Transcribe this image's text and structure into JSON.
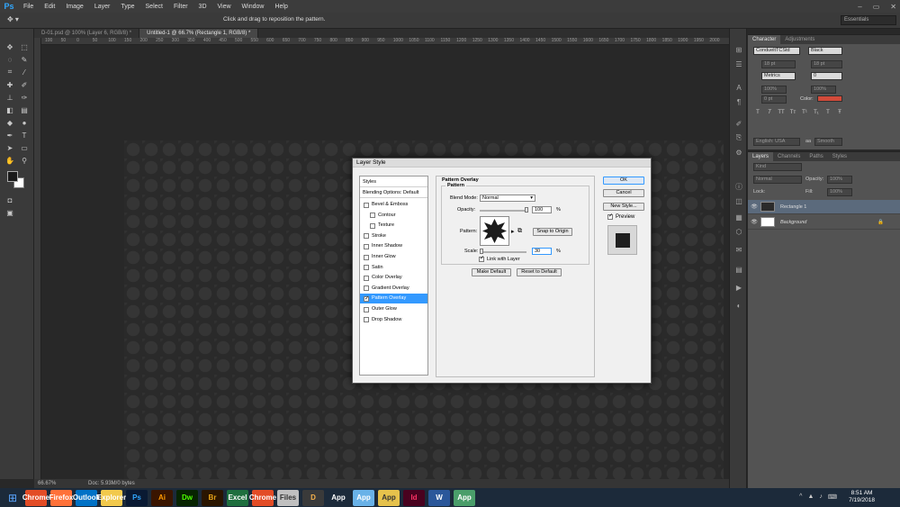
{
  "menubar": {
    "app_icon": "Ps",
    "items": [
      "File",
      "Edit",
      "Image",
      "Layer",
      "Type",
      "Select",
      "Filter",
      "3D",
      "View",
      "Window",
      "Help"
    ]
  },
  "options": {
    "hint": "Click and drag to reposition the pattern.",
    "workspace": "Essentials"
  },
  "tabs": [
    {
      "label": "D-01.psd @ 100% (Layer 6, RGB/8) *",
      "active": false
    },
    {
      "label": "Untitled-1 @ 66.7% (Rectangle 1, RGB/8) *",
      "active": true
    }
  ],
  "ruler_ticks": [
    "100",
    "50",
    "0",
    "50",
    "100",
    "150",
    "200",
    "250",
    "300",
    "350",
    "400",
    "450",
    "500",
    "550",
    "600",
    "650",
    "700",
    "750",
    "800",
    "850",
    "900",
    "950",
    "1000",
    "1050",
    "1100",
    "1150",
    "1200",
    "1250",
    "1300",
    "1350",
    "1400",
    "1450",
    "1500",
    "1550",
    "1600",
    "1650",
    "1700",
    "1750",
    "1800",
    "1850",
    "1900",
    "1950",
    "2000"
  ],
  "status": {
    "zoom": "66.67%",
    "doc": "Doc: 5.93M/0 bytes"
  },
  "character": {
    "tabs": [
      "Character",
      "Adjustments"
    ],
    "font": "CondueltTCStd",
    "style": "Black",
    "size": "18 pt",
    "leading": "18 pt",
    "kerning": "Metrics",
    "tracking": "0",
    "vscale": "100%",
    "hscale": "100%",
    "baseline": "0 pt",
    "color_label": "Color:",
    "language": "English: USA",
    "aa": "aa",
    "antialias": "Smooth"
  },
  "layers": {
    "tabs": [
      "Layers",
      "Channels",
      "Paths",
      "Styles"
    ],
    "filter": "Kind",
    "blend": "Normal",
    "opacity_label": "Opacity:",
    "opacity": "100%",
    "lock_label": "Lock:",
    "fill_label": "Fill:",
    "fill": "100%",
    "items": [
      {
        "name": "Rectangle 1",
        "selected": true
      },
      {
        "name": "Background",
        "selected": false
      }
    ]
  },
  "dialog": {
    "title": "Layer Style",
    "styles": [
      {
        "label": "Styles",
        "type": "header"
      },
      {
        "label": "Blending Options: Default",
        "type": "header"
      },
      {
        "label": "Bevel & Emboss",
        "checked": false,
        "indent": false,
        "selected": false
      },
      {
        "label": "Contour",
        "checked": false,
        "indent": true,
        "selected": false
      },
      {
        "label": "Texture",
        "checked": false,
        "indent": true,
        "selected": false
      },
      {
        "label": "Stroke",
        "checked": false,
        "indent": false,
        "selected": false
      },
      {
        "label": "Inner Shadow",
        "checked": false,
        "indent": false,
        "selected": false
      },
      {
        "label": "Inner Glow",
        "checked": false,
        "indent": false,
        "selected": false
      },
      {
        "label": "Satin",
        "checked": false,
        "indent": false,
        "selected": false
      },
      {
        "label": "Color Overlay",
        "checked": false,
        "indent": false,
        "selected": false
      },
      {
        "label": "Gradient Overlay",
        "checked": false,
        "indent": false,
        "selected": false
      },
      {
        "label": "Pattern Overlay",
        "checked": true,
        "indent": false,
        "selected": true
      },
      {
        "label": "Outer Glow",
        "checked": false,
        "indent": false,
        "selected": false
      },
      {
        "label": "Drop Shadow",
        "checked": false,
        "indent": false,
        "selected": false
      }
    ],
    "section_title": "Pattern Overlay",
    "group_title": "Pattern",
    "blend_mode_label": "Blend Mode:",
    "blend_mode": "Normal",
    "opacity_label": "Opacity:",
    "opacity_value": "100",
    "opacity_level": 1.0,
    "percent": "%",
    "pattern_label": "Pattern:",
    "snap_button": "Snap to Origin",
    "scale_label": "Scale:",
    "scale_value": "30",
    "scale_level": 0.03,
    "link_label": "Link with Layer",
    "link_checked": true,
    "make_default": "Make Default",
    "reset_default": "Reset to Default",
    "ok": "OK",
    "cancel": "Cancel",
    "new_style": "New Style...",
    "preview_label": "Preview",
    "preview_checked": true
  },
  "taskbar": {
    "apps": [
      "Chrome",
      "Firefox",
      "Outlook",
      "Explorer",
      "Ps",
      "Ai",
      "Dw",
      "Br",
      "Excel",
      "Chrome",
      "Files",
      "D",
      "App",
      "App",
      "App",
      "Id",
      "W",
      "App"
    ],
    "time": "8:51 AM",
    "date": "7/19/2018"
  },
  "colors": {
    "accent": "#3399ff",
    "ps_blue": "#31a8ff",
    "char_color": "#d24b3a"
  }
}
